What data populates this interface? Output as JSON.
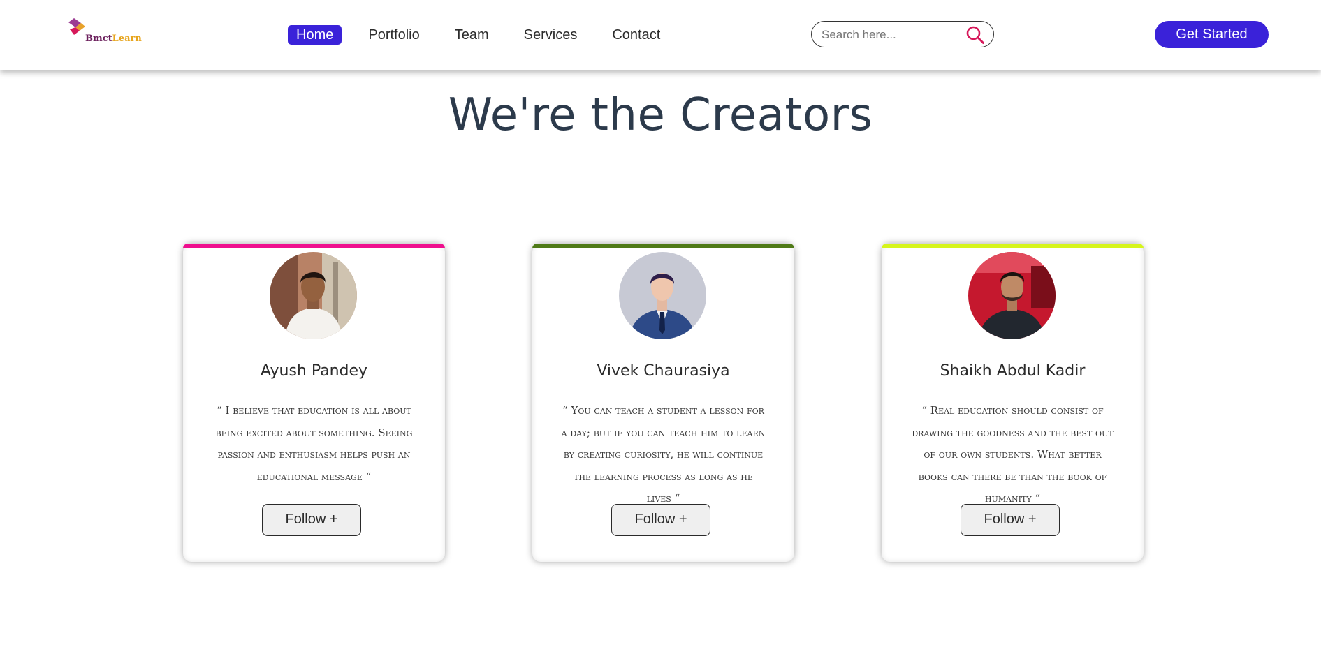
{
  "brand": {
    "name_part1": "Bmct",
    "name_part2": "Learn",
    "logo_icon": "bmctlearn-logo-icon"
  },
  "nav": {
    "items": [
      {
        "label": "Home",
        "active": true
      },
      {
        "label": "Portfolio",
        "active": false
      },
      {
        "label": "Team",
        "active": false
      },
      {
        "label": "Services",
        "active": false
      },
      {
        "label": "Contact",
        "active": false
      }
    ]
  },
  "search": {
    "placeholder": "Search here...",
    "value": "",
    "icon": "search-icon"
  },
  "cta": {
    "label": "Get Started"
  },
  "section": {
    "title": "We're the Creators"
  },
  "cards": [
    {
      "name": "Ayush Pandey",
      "quote": "“ I believe that education is all about being excited about something. Seeing passion and enthusiasm helps push an educational message “",
      "follow_label": "Follow +",
      "accent_color": "#ef0f8e",
      "avatar_icon": "avatar-photo"
    },
    {
      "name": "Vivek Chaurasiya",
      "quote": "“ You can teach a student a lesson for a day; but if you can teach him to learn by creating curiosity, he will continue the learning process as long as he lives “",
      "follow_label": "Follow +",
      "accent_color": "#4f7a17",
      "avatar_icon": "avatar-photo"
    },
    {
      "name": "Shaikh Abdul Kadir",
      "quote": "“ Real education should consist of drawing the goodness and the best out of our own students. What better books can there be than the book of humanity “",
      "follow_label": "Follow +",
      "accent_color": "#d6f51c",
      "avatar_icon": "avatar-photo"
    }
  ],
  "colors": {
    "primary": "#3a22d9",
    "heading": "#2c3a4b",
    "search_icon": "#d6185a"
  }
}
